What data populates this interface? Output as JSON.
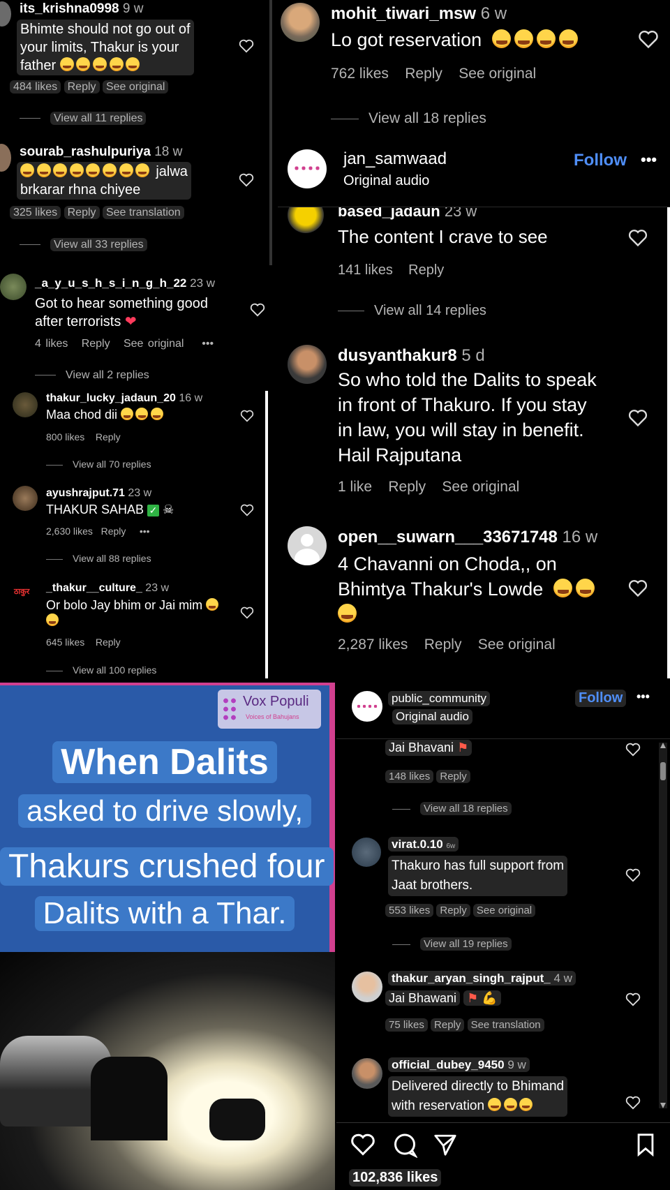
{
  "panel_a": {
    "c1": {
      "user": "its_krishna0998",
      "time": "9 w",
      "text1": "Bhimte should not go out of",
      "text2": "your limits, Thakur is your",
      "text3": "father",
      "likes": "484 likes",
      "reply": "Reply",
      "see": "See original",
      "view": "View all 11 replies"
    },
    "c2": {
      "user": "sourab_rashulpuriya",
      "time": "18 w",
      "text1": "jalwa",
      "text2": "brkarar rhna chiyee",
      "likes": "325 likes",
      "reply": "Reply",
      "see": "See translation",
      "view": "View all 33 replies"
    }
  },
  "panel_b": {
    "c1": {
      "user": "_a_y_u_s_h_s_i_n_g_h_22",
      "time": "23 w",
      "text1": "Got to hear something good",
      "text2": "after terrorists",
      "likes": "4 likes",
      "reply": "Reply",
      "see": "See original",
      "more": "•••",
      "view": "View all 2 replies"
    },
    "c2": {
      "user": "thakur_lucky_jadaun_20",
      "time": "16 w",
      "text": "Maa chod dii",
      "likes": "800 likes",
      "reply": "Reply",
      "view": "View all 70 replies"
    },
    "c3": {
      "user": "ayushrajput.71",
      "time": "23 w",
      "text": "THAKUR SAHAB",
      "likes": "2,630 likes",
      "reply": "Reply",
      "more": "•••",
      "view": "View all 88 replies"
    },
    "c4": {
      "user": "_thakur__culture_",
      "time": "23 w",
      "text": "Or bolo Jay bhim or Jai mim",
      "likes": "645 likes",
      "reply": "Reply",
      "view": "View all 100 replies"
    },
    "avatar_text": "ठाकुर"
  },
  "panel_c": {
    "c1": {
      "user": "mohit_tiwari_msw",
      "time": "6 w",
      "text": "Lo got reservation",
      "likes": "762 likes",
      "reply": "Reply",
      "see": "See original",
      "view": "View all 18 replies"
    }
  },
  "panel_d": {
    "header": {
      "account": "jan_samwaad",
      "audio": "Original audio",
      "follow": "Follow",
      "more": "•••"
    },
    "c1": {
      "user": "based_jadaun",
      "time": "23 w",
      "text": "The content I crave to see",
      "likes": "141 likes",
      "reply": "Reply",
      "view": "View all 14 replies"
    },
    "c2": {
      "user": "dusyanthakur8",
      "time": "5 d",
      "text1": "So who told the Dalits to speak",
      "text2": "in front of Thakuro. If you stay",
      "text3": "in law, you will stay in benefit.",
      "text4": "Hail Rajputana",
      "likes": "1 like",
      "reply": "Reply",
      "see": "See original"
    },
    "c3": {
      "user": "open__suwarn___33671748",
      "time": "16 w",
      "text1": "4 Chavanni on Choda,, on",
      "text2": "Bhimtya Thakur's Lowde",
      "likes": "2,287 likes",
      "reply": "Reply",
      "see": "See original"
    }
  },
  "panel_e": {
    "brand": "Vox Populi",
    "brand_sub": "Voices of Bahujans",
    "headline1": "When Dalits",
    "headline2": "asked to drive slowly,",
    "headline3": "Thakurs crushed four",
    "headline4": "Dalits with a Thar."
  },
  "panel_f": {
    "header": {
      "account": "public_community",
      "audio": "Original audio",
      "follow": "Follow",
      "more": "•••"
    },
    "c0": {
      "text": "Jai Bhavani",
      "likes": "148 likes",
      "reply": "Reply",
      "view": "View all 18 replies"
    },
    "c1": {
      "user": "virat.0.10",
      "time": "6w",
      "text1": "Thakuro has full support from",
      "text2": "Jaat brothers.",
      "likes": "553 likes",
      "reply": "Reply",
      "see": "See original",
      "view": "View all 19 replies"
    },
    "c2": {
      "user": "thakur_aryan_singh_rajput_",
      "time": "4 w",
      "text": "Jai Bhawani",
      "likes": "75 likes",
      "reply": "Reply",
      "see": "See translation"
    },
    "c3": {
      "user": "official_dubey_9450",
      "time": "9 w",
      "text1": "Delivered directly to Bhimand",
      "text2": "with reservation"
    },
    "footer": {
      "likes": "102,836 likes"
    }
  },
  "colors": {
    "background": "#000000",
    "link": "#4f8ef7",
    "bubble": "#262626",
    "slide_blue": "#2d68b5",
    "slide_border": "#d1408f"
  }
}
